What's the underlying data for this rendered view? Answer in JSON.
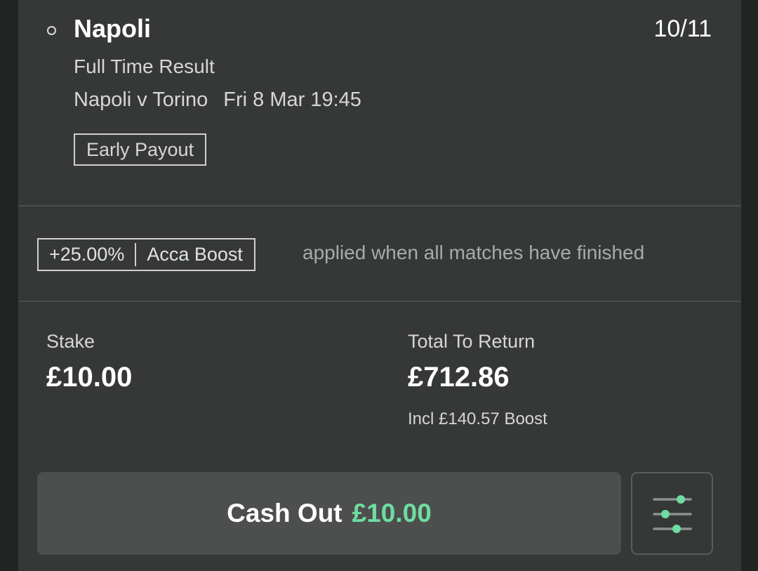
{
  "selection": {
    "name": "Napoli",
    "odds": "10/11",
    "market": "Full Time Result",
    "event": "Napoli v Torino",
    "datetime": "Fri 8 Mar 19:45",
    "badge": "Early Payout"
  },
  "boost": {
    "percent": "+25.00%",
    "label": "Acca Boost",
    "note": "applied when all matches have finished"
  },
  "bet": {
    "stake_label": "Stake",
    "stake_value": "£10.00",
    "return_label": "Total To Return",
    "return_value": "£712.86",
    "boost_incl": "Incl £140.57 Boost"
  },
  "cashout": {
    "label": "Cash Out",
    "amount": "£10.00"
  },
  "colors": {
    "accent": "#6fdca1",
    "card": "#353837",
    "background": "#222423"
  },
  "icons": {
    "radio": "radio-empty-icon",
    "settings": "sliders-icon"
  }
}
